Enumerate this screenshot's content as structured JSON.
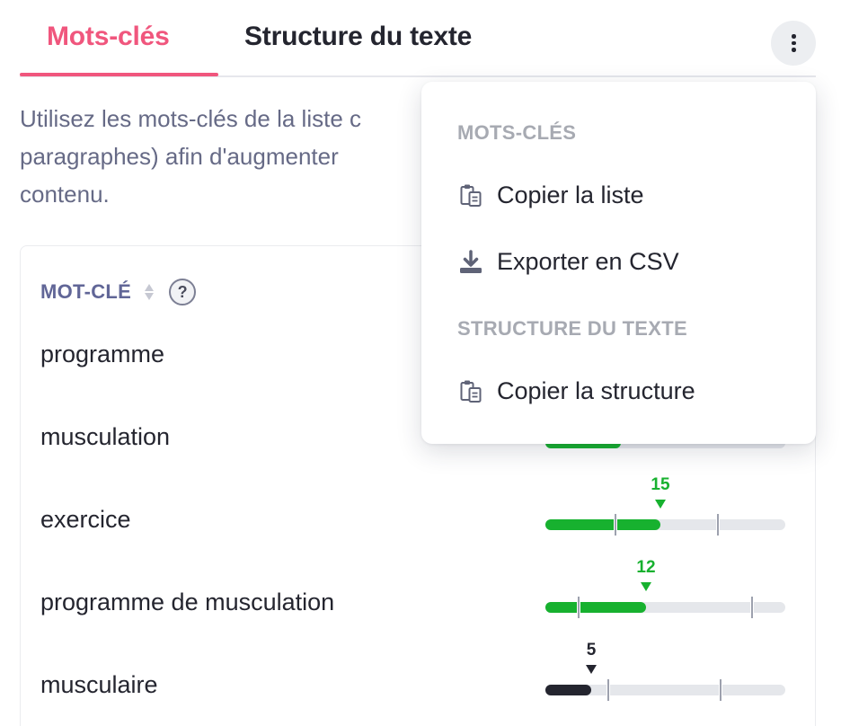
{
  "tabs": {
    "keywords_label": "Mots-clés",
    "structure_label": "Structure du texte",
    "active": "keywords",
    "more_icon": "more-vertical-icon"
  },
  "description": "Utilisez les mots-clés de la liste c paragraphes) afin d'augmenter contenu.",
  "description_lines": [
    "Utilisez les mots-clés de la liste c",
    "paragraphes) afin d'augmenter",
    "contenu."
  ],
  "table": {
    "column_header": "MOT-CLÉ",
    "help_label": "?",
    "rows": [
      {
        "keyword": "programme"
      },
      {
        "keyword": "musculation"
      },
      {
        "keyword": "exercice",
        "count": "15",
        "fraction": 0.48,
        "status": "green"
      },
      {
        "keyword": "programme de musculation",
        "count": "12",
        "fraction": 0.42,
        "status": "green"
      },
      {
        "keyword": "musculaire",
        "count": "5",
        "fraction": 0.19,
        "status": "dark"
      }
    ]
  },
  "menu": {
    "section_keywords": "MOTS-CLÉS",
    "copy_list": "Copier la liste",
    "export_csv": "Exporter en CSV",
    "section_structure": "STRUCTURE DU TEXTE",
    "copy_structure": "Copier la structure",
    "icons": [
      "clipboard-icon",
      "download-icon",
      "clipboard-icon"
    ]
  },
  "colors": {
    "accent_pink": "#f0567d",
    "bar_green": "#17b12f",
    "bar_dark": "#24252f",
    "track_gray": "#e5e7eb",
    "label_purple": "#616697",
    "section_gray": "#a7aab2"
  }
}
